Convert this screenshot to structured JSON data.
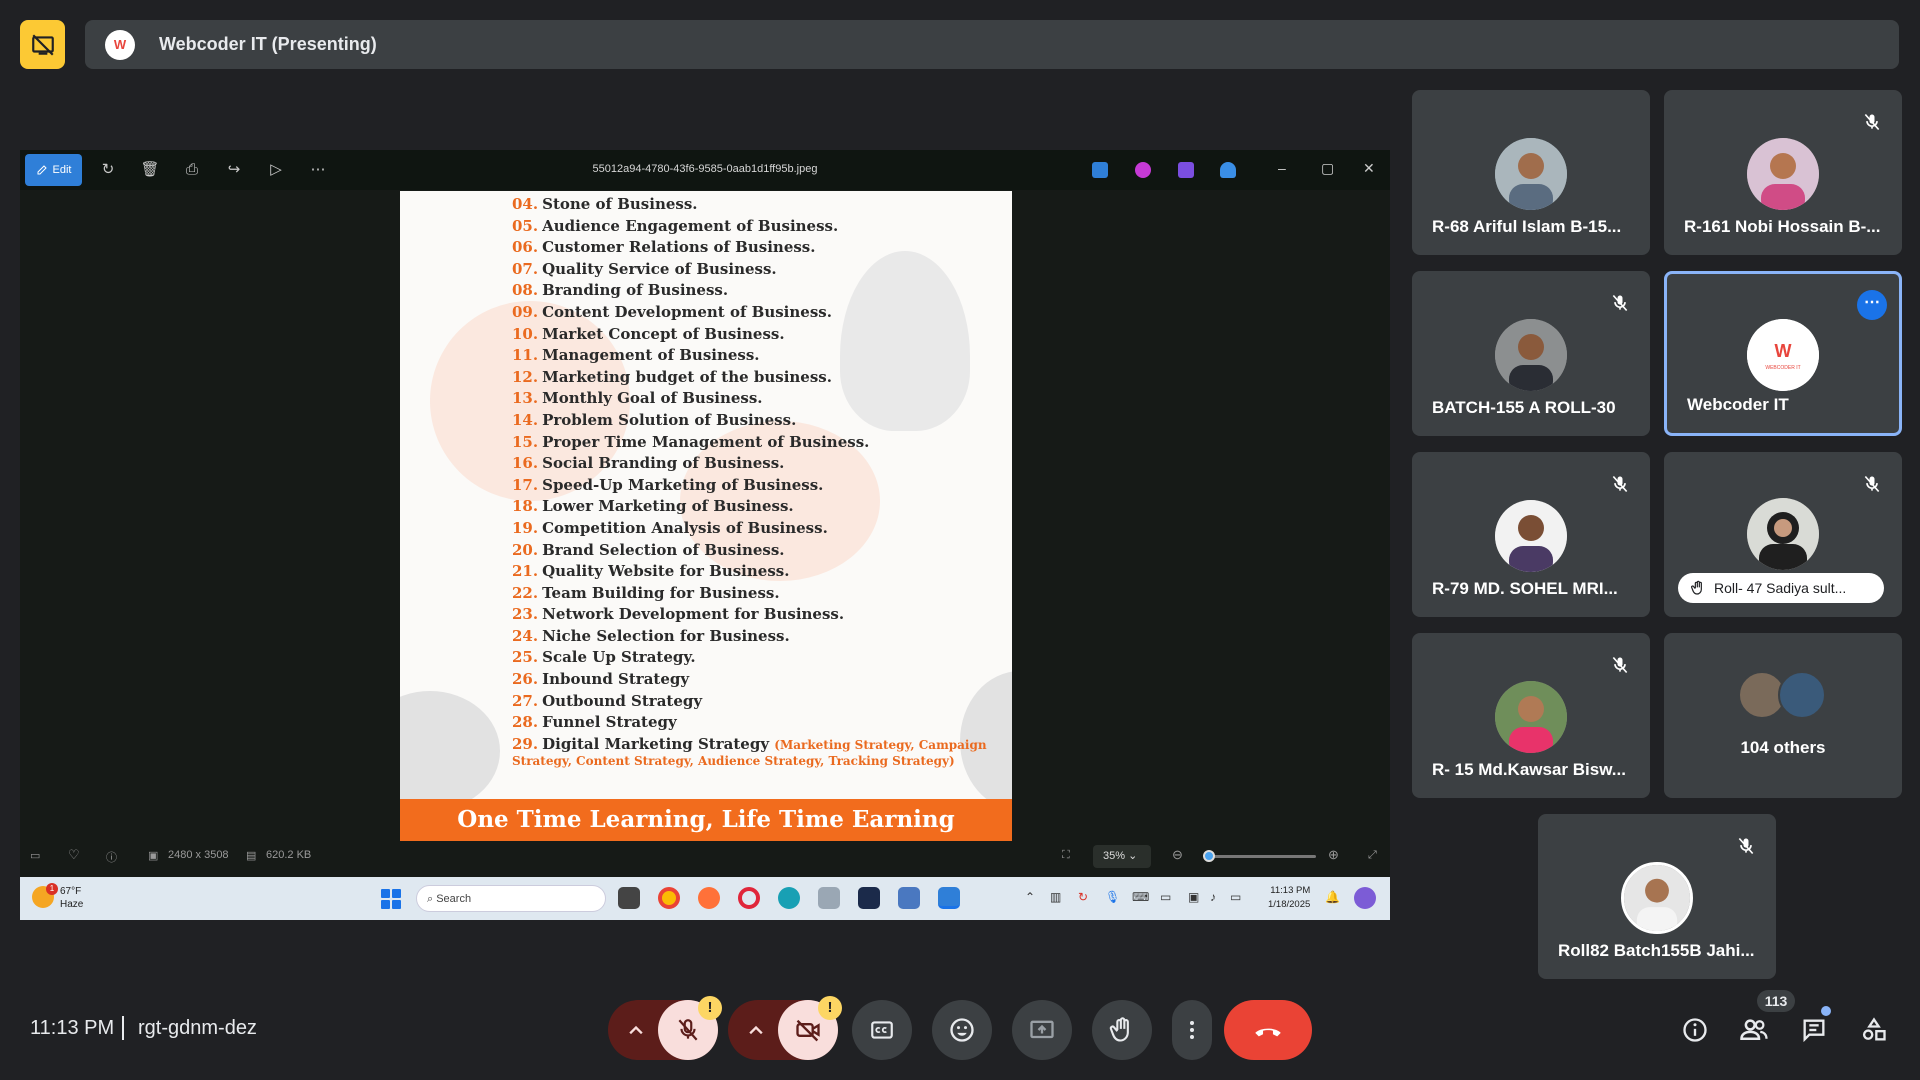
{
  "presenting": {
    "title": "Webcoder IT (Presenting)",
    "logo": "W"
  },
  "viewer": {
    "edit_label": "Edit",
    "file_name": "55012a94-4780-43f6-9585-0aab1d1ff95b.jpeg",
    "dimensions": "2480 x 3508",
    "file_size": "620.2 KB",
    "zoom": "35%"
  },
  "document": {
    "items": [
      {
        "n": "04.",
        "t": "Stone of Business."
      },
      {
        "n": "05.",
        "t": "Audience Engagement of Business."
      },
      {
        "n": "06.",
        "t": "Customer Relations of Business."
      },
      {
        "n": "07.",
        "t": "Quality Service of Business."
      },
      {
        "n": "08.",
        "t": "Branding of Business."
      },
      {
        "n": "09.",
        "t": "Content Development of Business."
      },
      {
        "n": "10.",
        "t": "Market Concept of Business."
      },
      {
        "n": "11.",
        "t": "Management of Business."
      },
      {
        "n": "12.",
        "t": "Marketing budget of the business."
      },
      {
        "n": "13.",
        "t": "Monthly Goal of Business."
      },
      {
        "n": "14.",
        "t": "Problem Solution of Business."
      },
      {
        "n": "15.",
        "t": "Proper Time Management of Business."
      },
      {
        "n": "16.",
        "t": "Social Branding of Business."
      },
      {
        "n": "17.",
        "t": "Speed-Up Marketing of Business."
      },
      {
        "n": "18.",
        "t": "Lower Marketing of Business."
      },
      {
        "n": "19.",
        "t": "Competition Analysis of Business."
      },
      {
        "n": "20.",
        "t": "Brand Selection of Business."
      },
      {
        "n": "21.",
        "t": "Quality Website for Business."
      },
      {
        "n": "22.",
        "t": "Team Building for Business."
      },
      {
        "n": "23.",
        "t": "Network Development for Business."
      },
      {
        "n": "24.",
        "t": "Niche Selection for Business."
      },
      {
        "n": "25.",
        "t": "Scale Up Strategy."
      },
      {
        "n": "26.",
        "t": "Inbound Strategy"
      },
      {
        "n": "27.",
        "t": "Outbound Strategy"
      },
      {
        "n": "28.",
        "t": "Funnel Strategy"
      }
    ],
    "last_item_num": "29.",
    "last_item_text": "Digital Marketing Strategy",
    "last_item_sub1": "(Marketing Strategy, Campaign",
    "last_item_sub2": "Strategy, Content Strategy, Audience Strategy, Tracking Strategy)",
    "banner": "One Time Learning, Life Time Earning"
  },
  "taskbar": {
    "weather_temp": "67°F",
    "weather_desc": "Haze",
    "weather_badge": "1",
    "search_placeholder": "Search",
    "clock_time": "11:13 PM",
    "clock_date": "1/18/2025"
  },
  "participants": [
    {
      "name": "R-68 Ariful Islam B-15..."
    },
    {
      "name": "R-161 Nobi Hossain B-..."
    },
    {
      "name": "BATCH-155 A ROLL-30"
    },
    {
      "name": "Webcoder IT"
    },
    {
      "name": "R-79 MD. SOHEL MRI..."
    },
    {
      "name": "Roll- 47 Sadiya sult..."
    },
    {
      "name": "R- 15 Md.Kawsar Bisw..."
    },
    {
      "name": "104 others"
    },
    {
      "name": "Roll82 Batch155B Jahi..."
    }
  ],
  "meeting": {
    "time": "11:13 PM",
    "code": "rgt-gdnm-dez",
    "people_count": "113",
    "warn_symbol": "!"
  },
  "colors": {
    "accent_orange": "#ea6a1f",
    "banner": "#f26c1d",
    "end_call": "#ea4335",
    "highlight": "#8ab4f8"
  }
}
